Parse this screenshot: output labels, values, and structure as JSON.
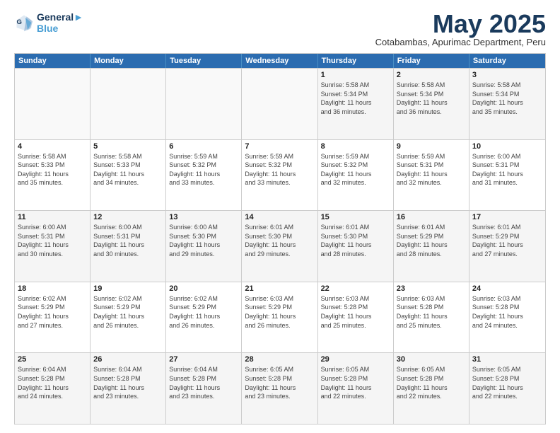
{
  "logo": {
    "line1": "General",
    "line2": "Blue"
  },
  "title": "May 2025",
  "subtitle": "Cotabambas, Apurimac Department, Peru",
  "weekdays": [
    "Sunday",
    "Monday",
    "Tuesday",
    "Wednesday",
    "Thursday",
    "Friday",
    "Saturday"
  ],
  "weeks": [
    [
      {
        "day": "",
        "info": ""
      },
      {
        "day": "",
        "info": ""
      },
      {
        "day": "",
        "info": ""
      },
      {
        "day": "",
        "info": ""
      },
      {
        "day": "1",
        "info": "Sunrise: 5:58 AM\nSunset: 5:34 PM\nDaylight: 11 hours\nand 36 minutes."
      },
      {
        "day": "2",
        "info": "Sunrise: 5:58 AM\nSunset: 5:34 PM\nDaylight: 11 hours\nand 36 minutes."
      },
      {
        "day": "3",
        "info": "Sunrise: 5:58 AM\nSunset: 5:34 PM\nDaylight: 11 hours\nand 35 minutes."
      }
    ],
    [
      {
        "day": "4",
        "info": "Sunrise: 5:58 AM\nSunset: 5:33 PM\nDaylight: 11 hours\nand 35 minutes."
      },
      {
        "day": "5",
        "info": "Sunrise: 5:58 AM\nSunset: 5:33 PM\nDaylight: 11 hours\nand 34 minutes."
      },
      {
        "day": "6",
        "info": "Sunrise: 5:59 AM\nSunset: 5:32 PM\nDaylight: 11 hours\nand 33 minutes."
      },
      {
        "day": "7",
        "info": "Sunrise: 5:59 AM\nSunset: 5:32 PM\nDaylight: 11 hours\nand 33 minutes."
      },
      {
        "day": "8",
        "info": "Sunrise: 5:59 AM\nSunset: 5:32 PM\nDaylight: 11 hours\nand 32 minutes."
      },
      {
        "day": "9",
        "info": "Sunrise: 5:59 AM\nSunset: 5:31 PM\nDaylight: 11 hours\nand 32 minutes."
      },
      {
        "day": "10",
        "info": "Sunrise: 6:00 AM\nSunset: 5:31 PM\nDaylight: 11 hours\nand 31 minutes."
      }
    ],
    [
      {
        "day": "11",
        "info": "Sunrise: 6:00 AM\nSunset: 5:31 PM\nDaylight: 11 hours\nand 30 minutes."
      },
      {
        "day": "12",
        "info": "Sunrise: 6:00 AM\nSunset: 5:31 PM\nDaylight: 11 hours\nand 30 minutes."
      },
      {
        "day": "13",
        "info": "Sunrise: 6:00 AM\nSunset: 5:30 PM\nDaylight: 11 hours\nand 29 minutes."
      },
      {
        "day": "14",
        "info": "Sunrise: 6:01 AM\nSunset: 5:30 PM\nDaylight: 11 hours\nand 29 minutes."
      },
      {
        "day": "15",
        "info": "Sunrise: 6:01 AM\nSunset: 5:30 PM\nDaylight: 11 hours\nand 28 minutes."
      },
      {
        "day": "16",
        "info": "Sunrise: 6:01 AM\nSunset: 5:29 PM\nDaylight: 11 hours\nand 28 minutes."
      },
      {
        "day": "17",
        "info": "Sunrise: 6:01 AM\nSunset: 5:29 PM\nDaylight: 11 hours\nand 27 minutes."
      }
    ],
    [
      {
        "day": "18",
        "info": "Sunrise: 6:02 AM\nSunset: 5:29 PM\nDaylight: 11 hours\nand 27 minutes."
      },
      {
        "day": "19",
        "info": "Sunrise: 6:02 AM\nSunset: 5:29 PM\nDaylight: 11 hours\nand 26 minutes."
      },
      {
        "day": "20",
        "info": "Sunrise: 6:02 AM\nSunset: 5:29 PM\nDaylight: 11 hours\nand 26 minutes."
      },
      {
        "day": "21",
        "info": "Sunrise: 6:03 AM\nSunset: 5:29 PM\nDaylight: 11 hours\nand 26 minutes."
      },
      {
        "day": "22",
        "info": "Sunrise: 6:03 AM\nSunset: 5:28 PM\nDaylight: 11 hours\nand 25 minutes."
      },
      {
        "day": "23",
        "info": "Sunrise: 6:03 AM\nSunset: 5:28 PM\nDaylight: 11 hours\nand 25 minutes."
      },
      {
        "day": "24",
        "info": "Sunrise: 6:03 AM\nSunset: 5:28 PM\nDaylight: 11 hours\nand 24 minutes."
      }
    ],
    [
      {
        "day": "25",
        "info": "Sunrise: 6:04 AM\nSunset: 5:28 PM\nDaylight: 11 hours\nand 24 minutes."
      },
      {
        "day": "26",
        "info": "Sunrise: 6:04 AM\nSunset: 5:28 PM\nDaylight: 11 hours\nand 23 minutes."
      },
      {
        "day": "27",
        "info": "Sunrise: 6:04 AM\nSunset: 5:28 PM\nDaylight: 11 hours\nand 23 minutes."
      },
      {
        "day": "28",
        "info": "Sunrise: 6:05 AM\nSunset: 5:28 PM\nDaylight: 11 hours\nand 23 minutes."
      },
      {
        "day": "29",
        "info": "Sunrise: 6:05 AM\nSunset: 5:28 PM\nDaylight: 11 hours\nand 22 minutes."
      },
      {
        "day": "30",
        "info": "Sunrise: 6:05 AM\nSunset: 5:28 PM\nDaylight: 11 hours\nand 22 minutes."
      },
      {
        "day": "31",
        "info": "Sunrise: 6:05 AM\nSunset: 5:28 PM\nDaylight: 11 hours\nand 22 minutes."
      }
    ]
  ]
}
